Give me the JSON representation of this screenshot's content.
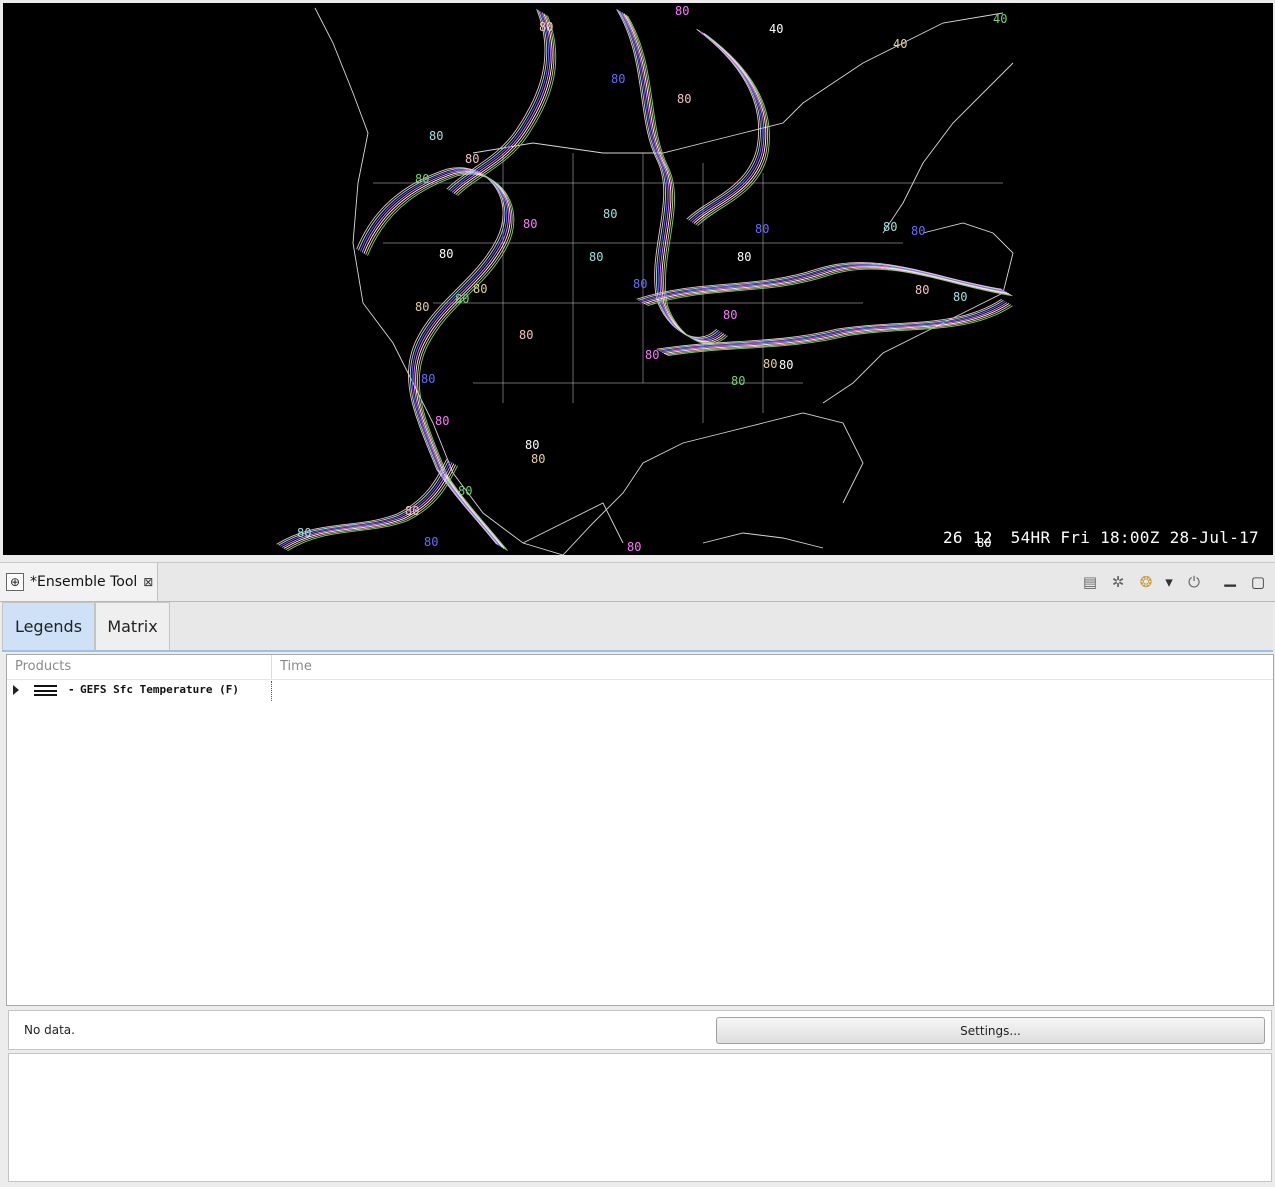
{
  "map": {
    "frame_counter": "26 12",
    "frame_time": "54HR Fri 18:00Z 28-Jul-17",
    "contour_labels": [
      "80",
      "40"
    ],
    "colors": {
      "background": "#000000",
      "coastline": "#d9d9d9",
      "contour_palette": [
        "#f4c2c2",
        "#9fe0e0",
        "#6a6aff",
        "#ff7aff",
        "#ffffff",
        "#e8d09a",
        "#7ad17a"
      ]
    }
  },
  "view": {
    "title": "*Ensemble Tool",
    "close_glyph": "⊠",
    "view_icon": "⊕",
    "toolbar": [
      {
        "icon": "notes-icon",
        "glyph": "▤"
      },
      {
        "icon": "tools-off-icon",
        "glyph": "✲"
      },
      {
        "icon": "cookie-icon",
        "glyph": "❂"
      },
      {
        "icon": "dropdown-arrow-icon",
        "glyph": "▾"
      },
      {
        "icon": "power-icon",
        "glyph": "⏻"
      },
      {
        "icon": "minimize-icon",
        "glyph": "▁"
      },
      {
        "icon": "maximize-icon",
        "glyph": "▢"
      }
    ]
  },
  "tabs": {
    "legends": "Legends",
    "matrix": "Matrix"
  },
  "tree": {
    "columns": {
      "products": "Products",
      "time": "Time"
    },
    "rows": [
      {
        "dash": "-",
        "label": "GEFS Sfc Temperature (F)",
        "time": ""
      }
    ]
  },
  "status": {
    "text": "No data.",
    "settings_label": "Settings..."
  }
}
